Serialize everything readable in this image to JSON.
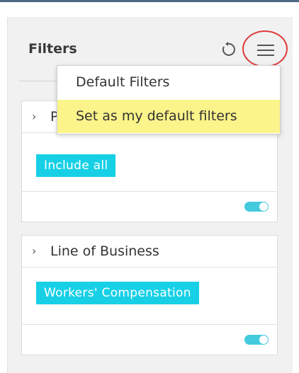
{
  "colors": {
    "accent": "#17d0e6",
    "highlight": "#fbf48a",
    "annotation": "#e03a3a"
  },
  "panel": {
    "title": "Filters",
    "reset_icon": "reset-icon",
    "menu_icon": "hamburger-menu-icon"
  },
  "menu": {
    "items": [
      {
        "label": "Default Filters",
        "highlighted": false
      },
      {
        "label": "Set as my default filters",
        "highlighted": true
      }
    ]
  },
  "cards": [
    {
      "label": "P",
      "chip": "Include all",
      "toggle_on": true
    },
    {
      "label": "Line of Business",
      "chip": "Workers' Compensation",
      "toggle_on": true
    }
  ]
}
